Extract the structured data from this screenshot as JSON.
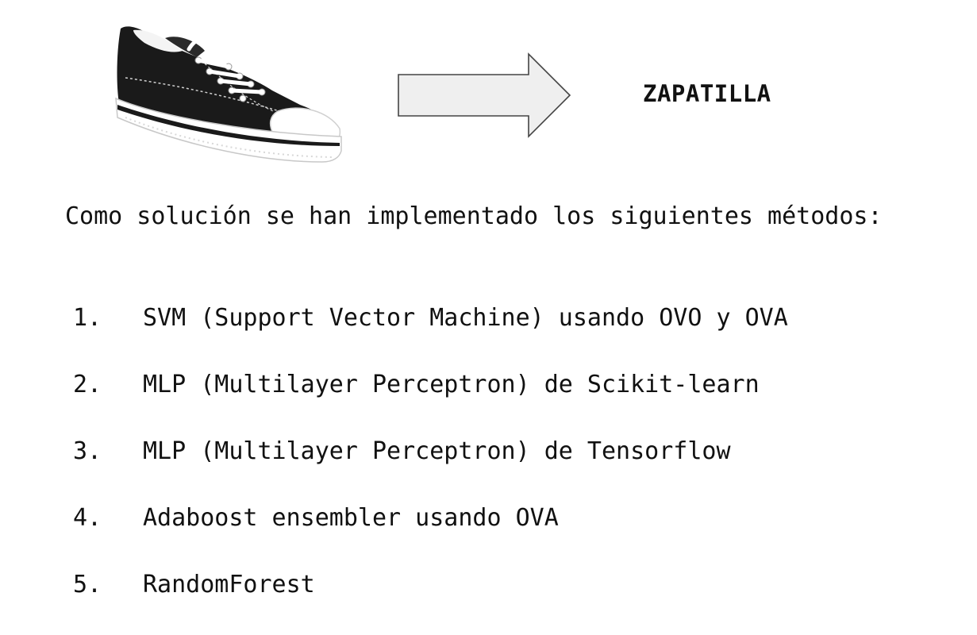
{
  "header": {
    "label": "ZAPATILLA"
  },
  "image": {
    "icon": "sneaker-image",
    "shoe_color": "#1a1a1a",
    "sole_color": "#ffffff"
  },
  "arrow": {
    "icon": "right-arrow-icon",
    "fill": "#efefef",
    "stroke": "#444444"
  },
  "intro": {
    "text": "Como solución se han implementado los siguientes métodos:"
  },
  "methods": [
    {
      "number": "1.",
      "text": "SVM (Support Vector Machine) usando OVO y OVA"
    },
    {
      "number": "2.",
      "text": "MLP (Multilayer Perceptron) de Scikit-learn"
    },
    {
      "number": "3.",
      "text": "MLP (Multilayer Perceptron) de Tensorflow"
    },
    {
      "number": "4.",
      "text": "Adaboost ensembler usando OVA"
    },
    {
      "number": "5.",
      "text": "RandomForest"
    }
  ]
}
